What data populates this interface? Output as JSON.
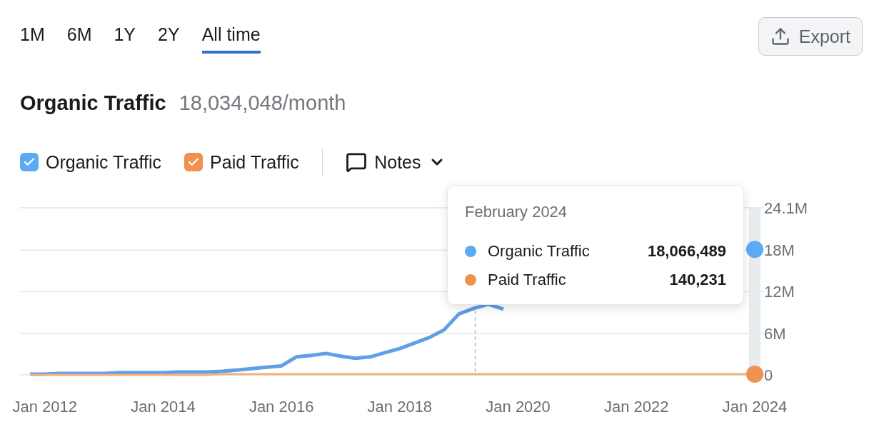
{
  "periods": [
    {
      "label": "1M",
      "selected": false
    },
    {
      "label": "6M",
      "selected": false
    },
    {
      "label": "1Y",
      "selected": false
    },
    {
      "label": "2Y",
      "selected": false
    },
    {
      "label": "All time",
      "selected": true
    }
  ],
  "export_button": {
    "label": "Export"
  },
  "summary": {
    "title": "Organic Traffic",
    "value": "18,034,048/month"
  },
  "legend": [
    {
      "checked": true,
      "color": "#5aabf4"
    },
    {
      "checked": true,
      "color": "#f0914f"
    }
  ],
  "notes": {
    "label": "Notes"
  },
  "chart": {
    "chart_data": {
      "type": "line",
      "categories": [
        null,
        "Jan 2012",
        null,
        null,
        null,
        null,
        null,
        null,
        null,
        "Jan 2014",
        null,
        null,
        null,
        null,
        null,
        null,
        null,
        "Jan 2016",
        null,
        null,
        null,
        null,
        null,
        null,
        null,
        "Jan 2018",
        null,
        null,
        null,
        null,
        null,
        null,
        null,
        "Jan 2020",
        null,
        null,
        null,
        null,
        null,
        null,
        null,
        "Jan 2022",
        null,
        null,
        null,
        null,
        null,
        null,
        null,
        "Jan 2024"
      ],
      "series": [
        {
          "name": "Organic Traffic",
          "color": "#5f9fe6",
          "values": [
            100000,
            100000,
            200000,
            200000,
            200000,
            200000,
            300000,
            300000,
            300000,
            300000,
            400000,
            400000,
            400000,
            500000,
            700000,
            900000,
            1100000,
            1300000,
            2600000,
            2800000,
            3100000,
            2700000,
            2400000,
            2600000,
            3200000,
            3800000,
            4600000,
            5400000,
            6500000,
            8800000,
            9600000,
            10200000,
            9500000,
            null,
            null,
            null,
            null,
            null,
            null,
            null,
            null,
            null,
            null,
            null,
            null,
            null,
            null,
            null,
            null,
            18100000
          ]
        },
        {
          "name": "Paid Traffic",
          "color": "#f0b27f",
          "values": [
            0,
            0,
            0,
            0,
            0,
            0,
            0,
            0,
            0,
            0,
            0,
            0,
            0,
            100000,
            100000,
            100000,
            100000,
            100000,
            100000,
            100000,
            100000,
            100000,
            100000,
            100000,
            100000,
            100000,
            100000,
            100000,
            100000,
            100000,
            100000,
            100000,
            100000,
            100000,
            100000,
            100000,
            100000,
            100000,
            100000,
            100000,
            100000,
            100000,
            100000,
            100000,
            100000,
            100000,
            100000,
            100000,
            100000,
            100000
          ]
        }
      ],
      "ylim": [
        0,
        24100000
      ],
      "grid": true,
      "yticks": [
        {
          "value": 0,
          "label": "0"
        },
        {
          "value": 6000000,
          "label": "6M"
        },
        {
          "value": 12000000,
          "label": "12M"
        },
        {
          "value": 18000000,
          "label": "18M"
        },
        {
          "value": 24100000,
          "label": "24.1M"
        }
      ]
    },
    "tooltip": {
      "title": "February 2024",
      "rows": [
        {
          "label": "Organic Traffic",
          "value": "18,066,489",
          "color": "#5aabf4"
        },
        {
          "label": "Paid Traffic",
          "value": "140,231",
          "color": "#f0914f"
        }
      ]
    }
  }
}
